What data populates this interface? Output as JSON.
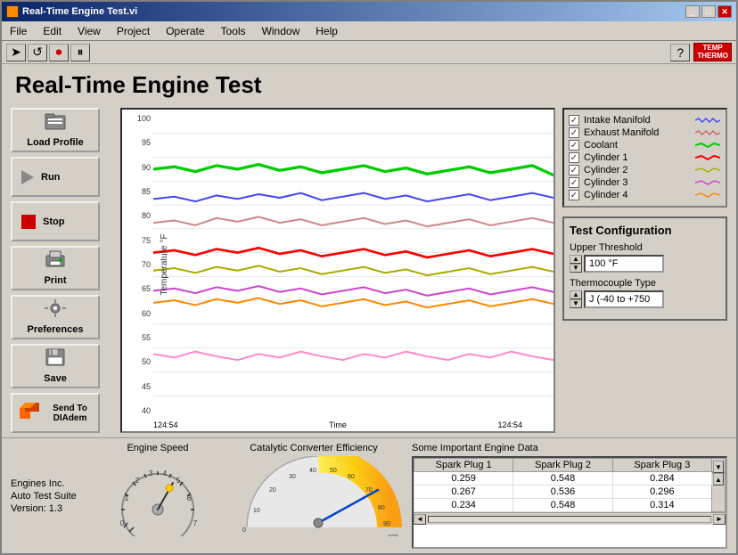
{
  "window": {
    "title": "Real-Time Engine Test.vi",
    "app_title": "Real-Time Engine Test"
  },
  "menu": {
    "items": [
      "File",
      "Edit",
      "View",
      "Project",
      "Operate",
      "Tools",
      "Window",
      "Help"
    ]
  },
  "toolbar": {
    "temp_label": "TEMP\nTHERMO"
  },
  "sidebar": {
    "buttons": [
      {
        "id": "load-profile",
        "label": "Load Profile",
        "icon": "📁"
      },
      {
        "id": "run",
        "label": "Run",
        "icon": "▶"
      },
      {
        "id": "stop",
        "label": "Stop",
        "icon": "stop"
      },
      {
        "id": "print",
        "label": "Print",
        "icon": "🖨"
      },
      {
        "id": "preferences",
        "label": "Preferences",
        "icon": "⚙"
      },
      {
        "id": "save",
        "label": "Save",
        "icon": "💾"
      },
      {
        "id": "send-to-diadem",
        "label": "Send To DIAdem",
        "icon": "📊"
      }
    ]
  },
  "chart": {
    "y_axis_label": "Temperature °F",
    "x_axis_label": "Time",
    "x_start": "124:54",
    "x_end": "124:54",
    "y_ticks": [
      "100",
      "95",
      "90",
      "85",
      "80",
      "75",
      "70",
      "65",
      "60",
      "55",
      "50",
      "45",
      "40"
    ]
  },
  "legend": {
    "items": [
      {
        "label": "Intake Manifold",
        "color": "#4444ff",
        "checked": true,
        "line_type": "zigzag"
      },
      {
        "label": "Exhaust Manifold",
        "color": "#ff4444",
        "checked": true,
        "line_type": "zigzag"
      },
      {
        "label": "Coolant",
        "color": "#00cc00",
        "checked": true,
        "line_type": "smooth"
      },
      {
        "label": "Cylinder 1",
        "color": "#ff0000",
        "checked": true,
        "line_type": "smooth"
      },
      {
        "label": "Cylinder 2",
        "color": "#cccc00",
        "checked": true,
        "line_type": "smooth"
      },
      {
        "label": "Cylinder 3",
        "color": "#cc44cc",
        "checked": true,
        "line_type": "smooth"
      },
      {
        "label": "Cylinder 4",
        "color": "#ff8800",
        "checked": true,
        "line_type": "smooth"
      }
    ]
  },
  "test_config": {
    "title": "Test Configuration",
    "upper_threshold_label": "Upper Threshold",
    "upper_threshold_value": "100 °F",
    "thermocouple_label": "Thermocouple Type",
    "thermocouple_value": "J (-40 to +750"
  },
  "bottom": {
    "engine_speed_title": "Engine Speed",
    "catalytic_title": "Catalytic Converter Efficiency",
    "data_title": "Some Important Engine Data",
    "info": {
      "line1": "Engines Inc.",
      "line2": "Auto Test Suite",
      "line3": "Version: 1.3"
    },
    "table": {
      "headers": [
        "Spark Plug 1",
        "Spark Plug 2",
        "Spark Plug 3"
      ],
      "rows": [
        [
          "0.259",
          "0.548",
          "0.284"
        ],
        [
          "0.267",
          "0.536",
          "0.296"
        ],
        [
          "0.234",
          "0.548",
          "0.314"
        ]
      ]
    }
  }
}
